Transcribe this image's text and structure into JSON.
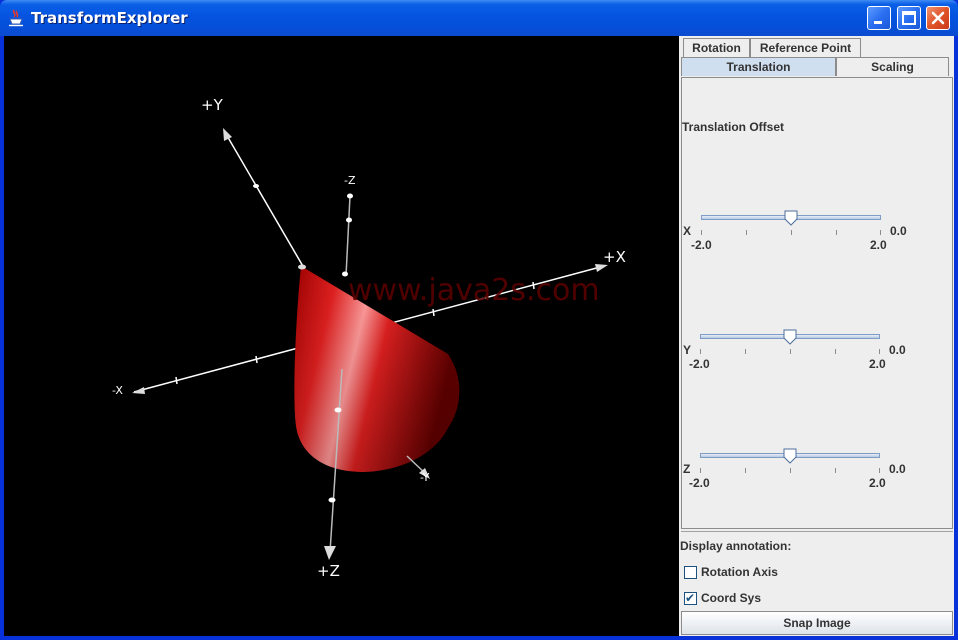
{
  "window": {
    "title": "TransformExplorer"
  },
  "scene": {
    "axis_labels": {
      "plus_y": "+Y",
      "minus_z": "-Z",
      "plus_x": "+X",
      "minus_x": "-X",
      "minus_y": "-Y",
      "plus_z": "+Z"
    },
    "watermark": "www.java2s.com",
    "cone_color": "#d40000"
  },
  "tabs": {
    "row1": [
      "Rotation",
      "Reference Point"
    ],
    "row2": [
      "Translation",
      "Scaling"
    ],
    "selected": "Translation"
  },
  "translation": {
    "heading": "Translation Offset",
    "sliders": [
      {
        "axis": "X",
        "value": "0.0",
        "min_label": "-2.0",
        "max_label": "2.0",
        "position": 0.5
      },
      {
        "axis": "Y",
        "value": "0.0",
        "min_label": "-2.0",
        "max_label": "2.0",
        "position": 0.5
      },
      {
        "axis": "Z",
        "value": "0.0",
        "min_label": "-2.0",
        "max_label": "2.0",
        "position": 0.5
      }
    ]
  },
  "annotation": {
    "heading": "Display annotation:",
    "rotation_axis": {
      "label": "Rotation Axis",
      "checked": false
    },
    "coord_sys": {
      "label": "Coord Sys",
      "checked": true
    }
  },
  "snap_button": "Snap Image",
  "colors": {
    "titlebar": "#0553e0",
    "selected_tab": "#cfdff0",
    "panel_bg": "#eeeeee"
  }
}
